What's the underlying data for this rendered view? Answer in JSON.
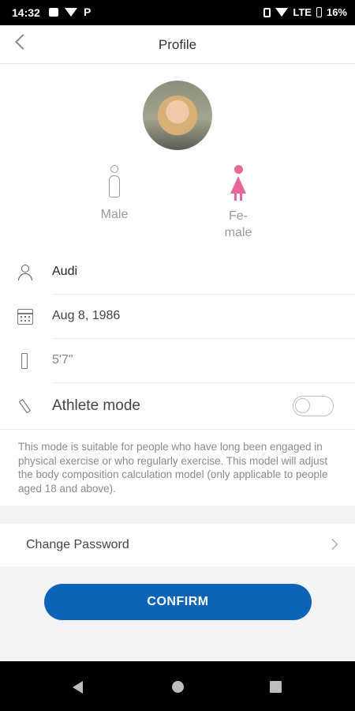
{
  "status_bar": {
    "time": "14:32",
    "network": "LTE",
    "battery": "16%"
  },
  "header": {
    "title": "Profile",
    "back_icon": "chevron-left-icon"
  },
  "profile": {
    "gender_options": [
      {
        "label": "Male",
        "icon": "male-icon",
        "selected": false
      },
      {
        "label": "Fe-\nmale",
        "icon": "female-icon",
        "selected": true
      }
    ],
    "fields": {
      "name": "Audi",
      "birthdate": "Aug 8, 1986",
      "height": "5'7\""
    },
    "athlete_mode": {
      "label": "Athlete mode",
      "enabled": false,
      "description": "This mode is suitable for people who have long been engaged in physical exercise or who regularly exercise. This model will adjust the body composition calculation model (only applicable to people aged 18 and above)."
    }
  },
  "change_password": {
    "label": "Change Password"
  },
  "actions": {
    "confirm_label": "CONFIRM"
  },
  "colors": {
    "accent": "#0b64b8",
    "female_selected": "#e8679b"
  }
}
